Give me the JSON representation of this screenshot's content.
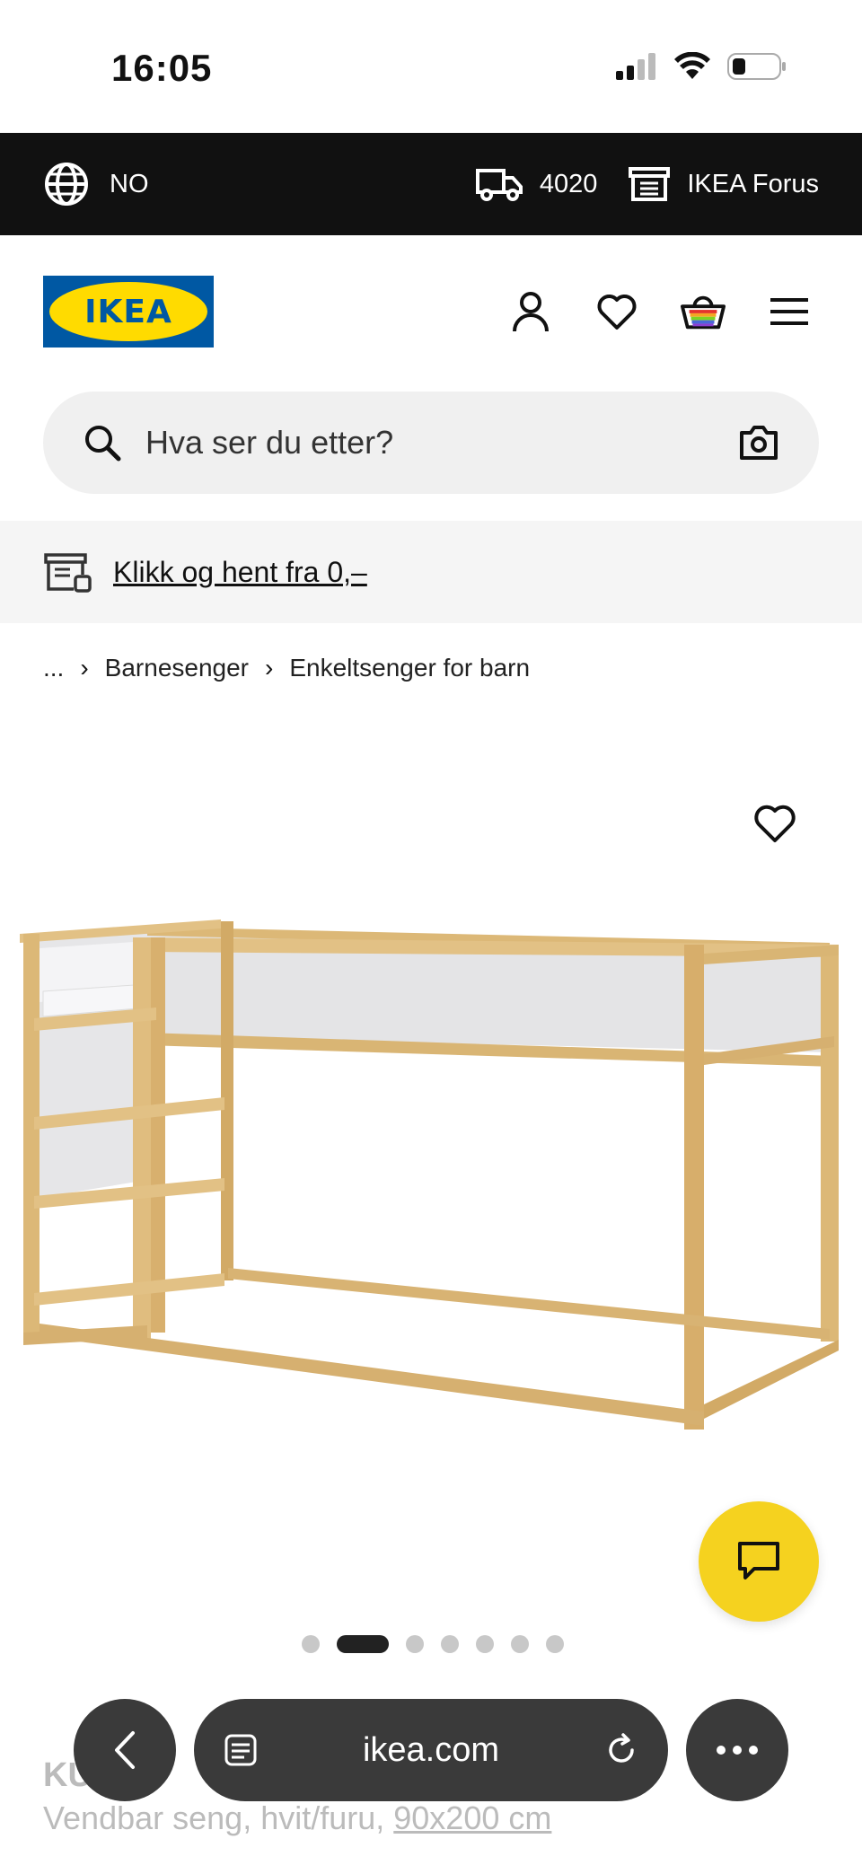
{
  "status_bar": {
    "time": "16:05"
  },
  "top_bar": {
    "language": "NO",
    "postal_code": "4020",
    "store": "IKEA Forus"
  },
  "header": {
    "logo_text": "IKEA"
  },
  "search": {
    "placeholder": "Hva ser du etter?"
  },
  "promo": {
    "text": "Klikk og hent fra 0,–"
  },
  "breadcrumb": {
    "ellipsis": "...",
    "items": [
      "Barnesenger",
      "Enkeltsenger for barn"
    ]
  },
  "carousel": {
    "total": 7,
    "active_index": 1
  },
  "product": {
    "name": "KURA",
    "description": "Vendbar seng, hvit/furu,",
    "size": "90x200 cm"
  },
  "browser": {
    "url": "ikea.com"
  },
  "colors": {
    "ikea_blue": "#0058a3",
    "ikea_yellow": "#ffdb00",
    "chat_yellow": "#f5d21f"
  }
}
